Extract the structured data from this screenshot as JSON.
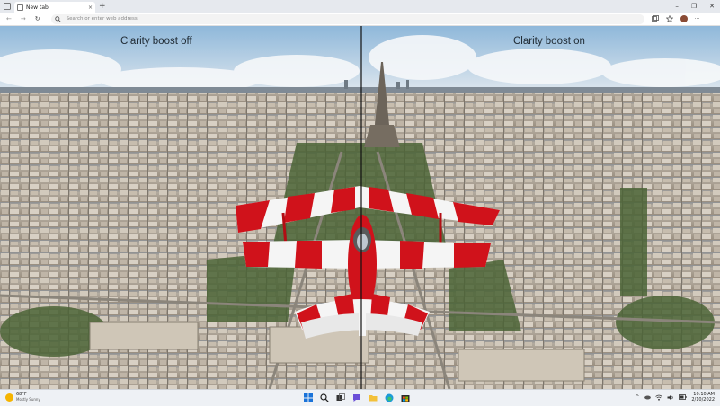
{
  "browser": {
    "tab_title": "New tab",
    "tab_close": "×",
    "new_tab": "+",
    "window_controls": [
      "–",
      "❐",
      "✕"
    ],
    "nav": [
      "←",
      "→",
      "↻"
    ],
    "address_placeholder": "Search or enter web address",
    "toolbar_icons": [
      "collections-icon",
      "favorites-icon",
      "profile-avatar"
    ]
  },
  "content": {
    "left_label": "Clarity boost off",
    "right_label": "Clarity boost on"
  },
  "taskbar": {
    "weather_temp": "68°F",
    "weather_condition": "Mostly Sunny",
    "pinned_apps": [
      "windows-start-icon",
      "search-icon",
      "task-view-icon",
      "chat-icon",
      "file-explorer-icon",
      "edge-icon",
      "store-icon"
    ],
    "tray_caret": "^",
    "time": "10:10 AM",
    "date": "2/10/2022"
  },
  "colors": {
    "plane_red": "#d0121b",
    "plane_white": "#f5f5f5",
    "sky": "#9cc3e0",
    "city": "#b9b1a4",
    "trees": "#4f6a3a"
  }
}
